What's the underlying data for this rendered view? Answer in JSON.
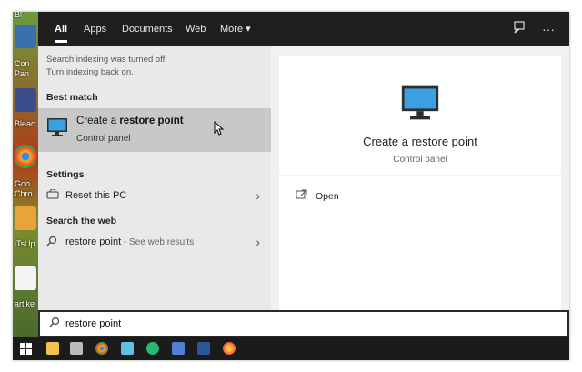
{
  "tabs": [
    "All",
    "Apps",
    "Documents",
    "Web",
    "More"
  ],
  "notice": [
    "Search indexing was turned off.",
    "Turn indexing back on."
  ],
  "best_match": {
    "heading": "Best match",
    "title_prefix": "Create a ",
    "title_bold": "restore point",
    "subtitle": "Control panel"
  },
  "settings": {
    "heading": "Settings",
    "item": "Reset this PC"
  },
  "web": {
    "heading": "Search the web",
    "query": "restore point",
    "suffix": " - See web results"
  },
  "detail": {
    "title": "Create a restore point",
    "subtitle": "Control panel",
    "action": "Open"
  },
  "search_box": {
    "value": "restore point"
  },
  "desktop_labels": [
    "Bl",
    "Con",
    "Pan",
    "Bleac",
    "Goo",
    "Chro",
    "iTsUp",
    "artike"
  ],
  "colors": {
    "dark": "#1f1f1f",
    "selected": "#c8c8c8",
    "panel": "#e9e9e9"
  }
}
